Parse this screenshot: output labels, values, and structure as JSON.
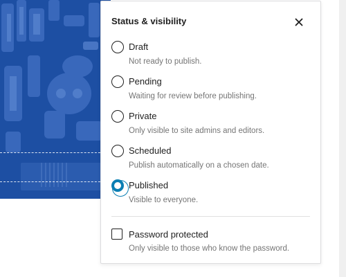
{
  "popover": {
    "title": "Status & visibility",
    "close_icon": "close-icon"
  },
  "status_options": [
    {
      "label": "Draft",
      "description": "Not ready to publish.",
      "selected": false
    },
    {
      "label": "Pending",
      "description": "Waiting for review before publishing.",
      "selected": false
    },
    {
      "label": "Private",
      "description": "Only visible to site admins and editors.",
      "selected": false
    },
    {
      "label": "Scheduled",
      "description": "Publish automatically on a chosen date.",
      "selected": false
    },
    {
      "label": "Published",
      "description": "Visible to everyone.",
      "selected": true
    }
  ],
  "password": {
    "label": "Password protected",
    "description": "Only visible to those who know the password.",
    "checked": false
  },
  "colors": {
    "accent": "#0a7eb3",
    "text": "#1e1e1e",
    "muted": "#757575",
    "image_blue": "#1d4fa3"
  }
}
